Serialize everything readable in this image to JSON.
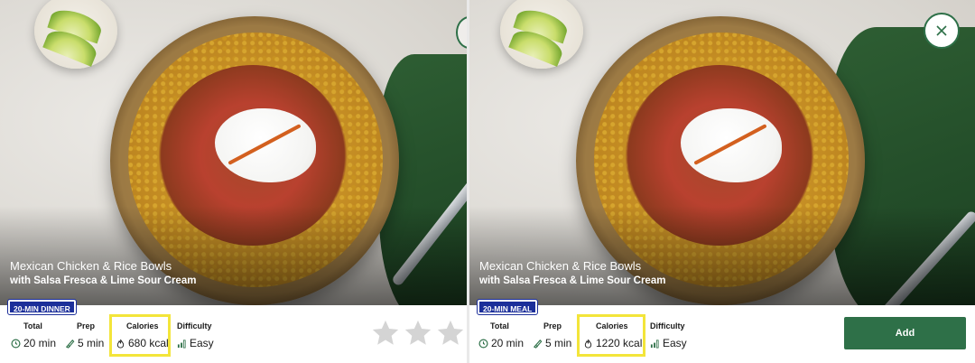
{
  "cards": [
    {
      "title": "Mexican Chicken & Rice Bowls",
      "subtitle": "with Salsa Fresca & Lime Sour Cream",
      "badge": "20-MIN DINNER",
      "stats": {
        "total_label": "Total",
        "total_value": "20 min",
        "prep_label": "Prep",
        "prep_value": "5 min",
        "calories_label": "Calories",
        "calories_value": "680 kcal",
        "difficulty_label": "Difficulty",
        "difficulty_value": "Easy"
      },
      "rating_stars": 3
    },
    {
      "title": "Mexican Chicken & Rice Bowls",
      "subtitle": "with Salsa Fresca & Lime Sour Cream",
      "badge": "20-MIN MEAL",
      "stats": {
        "total_label": "Total",
        "total_value": "20 min",
        "prep_label": "Prep",
        "prep_value": "5 min",
        "calories_label": "Calories",
        "calories_value": "1220 kcal",
        "difficulty_label": "Difficulty",
        "difficulty_value": "Easy"
      },
      "add_label": "Add",
      "close_icon": "close-icon"
    }
  ],
  "colors": {
    "badge": "#1c2f9a",
    "add_button": "#2e7048",
    "highlight": "#f3e53a",
    "star": "#d4d4d4"
  }
}
